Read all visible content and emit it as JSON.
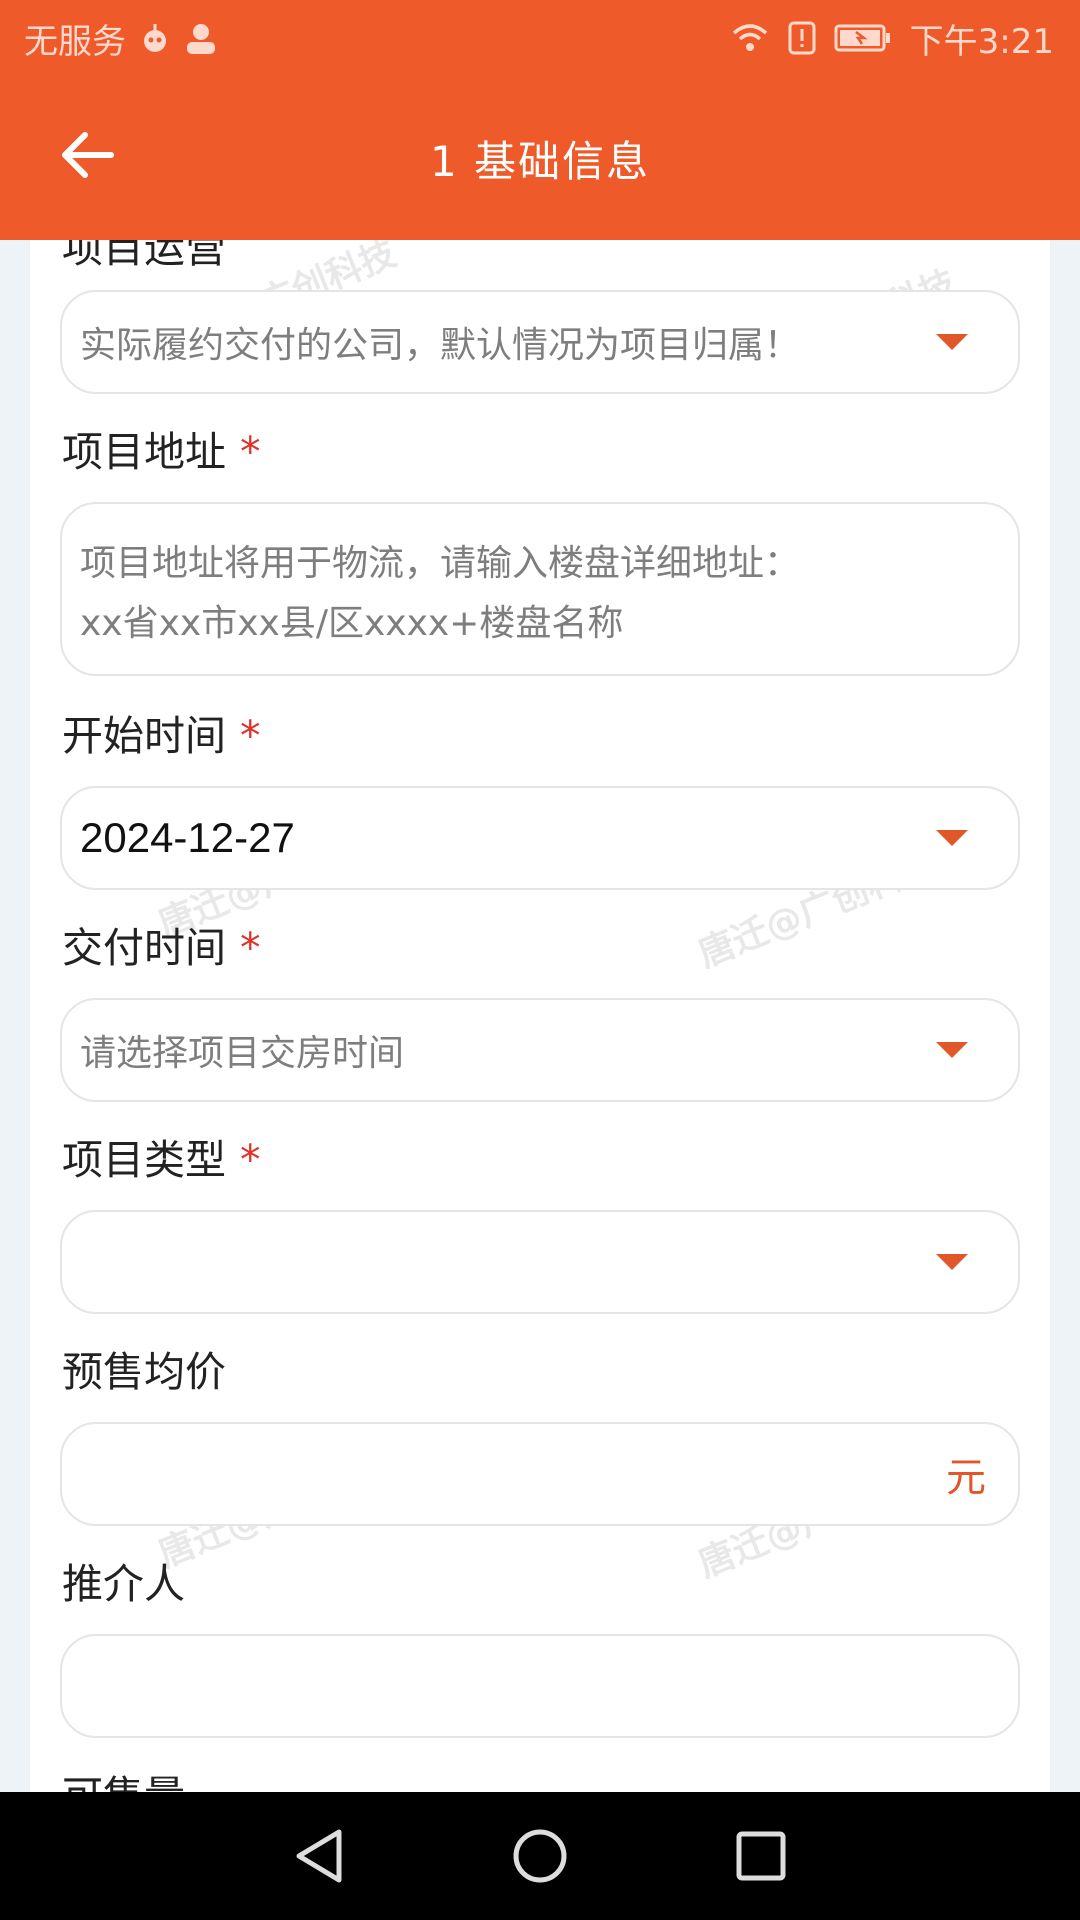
{
  "status_bar": {
    "carrier": "无服务",
    "time": "下午3:21"
  },
  "app_bar": {
    "title": "1 基础信息",
    "back_icon": "arrow-left-icon"
  },
  "form": {
    "partial_top_label": "项目运营",
    "delivery_company": {
      "placeholder": "实际履约交付的公司，默认情况为项目归属！"
    },
    "address": {
      "label": "项目地址",
      "required_mark": "*",
      "placeholder_line1": "项目地址将用于物流，请输入楼盘详细地址：",
      "placeholder_line2": "xx省xx市xx县/区xxxx+楼盘名称"
    },
    "start_time": {
      "label": "开始时间",
      "required_mark": "*",
      "value": "2024-12-27"
    },
    "delivery_time": {
      "label": "交付时间",
      "required_mark": "*",
      "placeholder": "请选择项目交房时间"
    },
    "project_type": {
      "label": "项目类型",
      "required_mark": "*",
      "value": ""
    },
    "presale_price": {
      "label": "预售均价",
      "suffix": "元",
      "value": ""
    },
    "referrer": {
      "label": "推介人",
      "value": ""
    },
    "partial_bottom_label": "可售量"
  },
  "watermark_text": "唐迁@广创科技",
  "colors": {
    "accent": "#ef5a2a",
    "required": "#e0322a"
  }
}
